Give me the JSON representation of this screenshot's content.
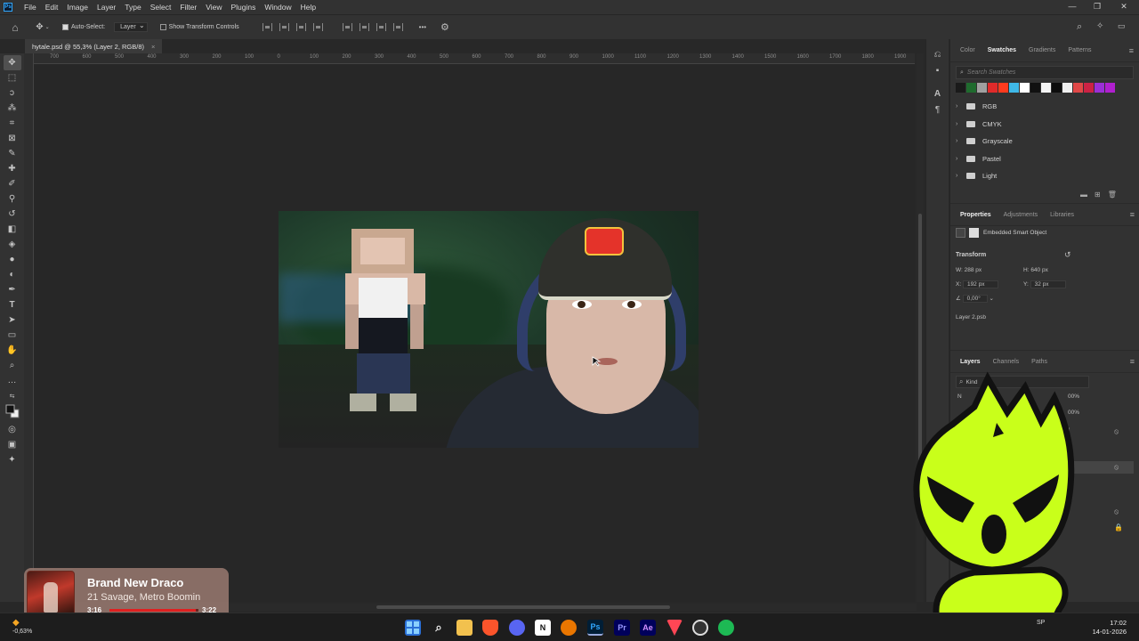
{
  "app": {
    "logo": "Ps"
  },
  "menu": [
    "File",
    "Edit",
    "Image",
    "Layer",
    "Type",
    "Select",
    "Filter",
    "View",
    "Plugins",
    "Window",
    "Help"
  ],
  "window_controls": {
    "minimize": "—",
    "restore": "❐",
    "close": "✕"
  },
  "options_bar": {
    "auto_select_label": "Auto-Select:",
    "auto_select_target": "Layer",
    "show_transform_label": "Show Transform Controls",
    "more": "•••"
  },
  "document": {
    "tab_title": "hytale.psd @ 55,3% (Layer 2, RGB/8)",
    "close": "×"
  },
  "ruler_ticks": [
    "700",
    "600",
    "500",
    "400",
    "300",
    "200",
    "100",
    "0",
    "100",
    "200",
    "300",
    "400",
    "500",
    "600",
    "700",
    "800",
    "900",
    "1000",
    "1100",
    "1200",
    "1300",
    "1400",
    "1500",
    "1600",
    "1700",
    "1800",
    "1900"
  ],
  "swatches_panel": {
    "tabs": [
      "Color",
      "Swatches",
      "Gradients",
      "Patterns"
    ],
    "active_tab": "Swatches",
    "search_placeholder": "Search Swatches",
    "swatch_colors": [
      "#1a1a1a",
      "#1f6b2e",
      "#a0a0a0",
      "#e02a2a",
      "#ff3b1e",
      "#3fb8e8",
      "#ffffff",
      "#111111",
      "#f5f5f5",
      "#0d0d0d",
      "#f0f0f0",
      "#e04848",
      "#cc2244",
      "#9b2fd6",
      "#b01fcf"
    ],
    "folders": [
      "RGB",
      "CMYK",
      "Grayscale",
      "Pastel",
      "Light"
    ]
  },
  "properties_panel": {
    "tabs": [
      "Properties",
      "Adjustments",
      "Libraries"
    ],
    "active_tab": "Properties",
    "object_type": "Embedded Smart Object",
    "transform_label": "Transform",
    "w": "288 px",
    "h": "640 px",
    "x": "192 px",
    "y": "32 px",
    "angle": "0,00°",
    "linked_file": "Layer 2.psb"
  },
  "layers_panel": {
    "tabs": [
      "Layers",
      "Channels",
      "Paths"
    ],
    "active_tab": "Layers",
    "filter_kind": "Kind",
    "opacity_fragment": "00%",
    "fill_fragment": "00%",
    "blend_fragment": "N",
    "propagate_fragment": "nced"
  },
  "now_playing": {
    "title": "Brand New Draco",
    "artist": "21 Savage, Metro Boomin",
    "elapsed": "3:16",
    "duration": "3:22",
    "progress": 0.97
  },
  "taskbar": {
    "stock_line1": "",
    "stock_change": "-0,63%",
    "apps": [
      "windows-start",
      "search",
      "file-explorer",
      "brave",
      "discord",
      "notion",
      "blender",
      "photoshop",
      "premiere",
      "after-effects",
      "valorant",
      "chrome",
      "spotify"
    ],
    "ps_label": "Ps",
    "pr_label": "Pr",
    "ae_label": "Ae",
    "n_label": "N",
    "lang": "SP",
    "time": "17:02",
    "date": "14-01-2026"
  }
}
